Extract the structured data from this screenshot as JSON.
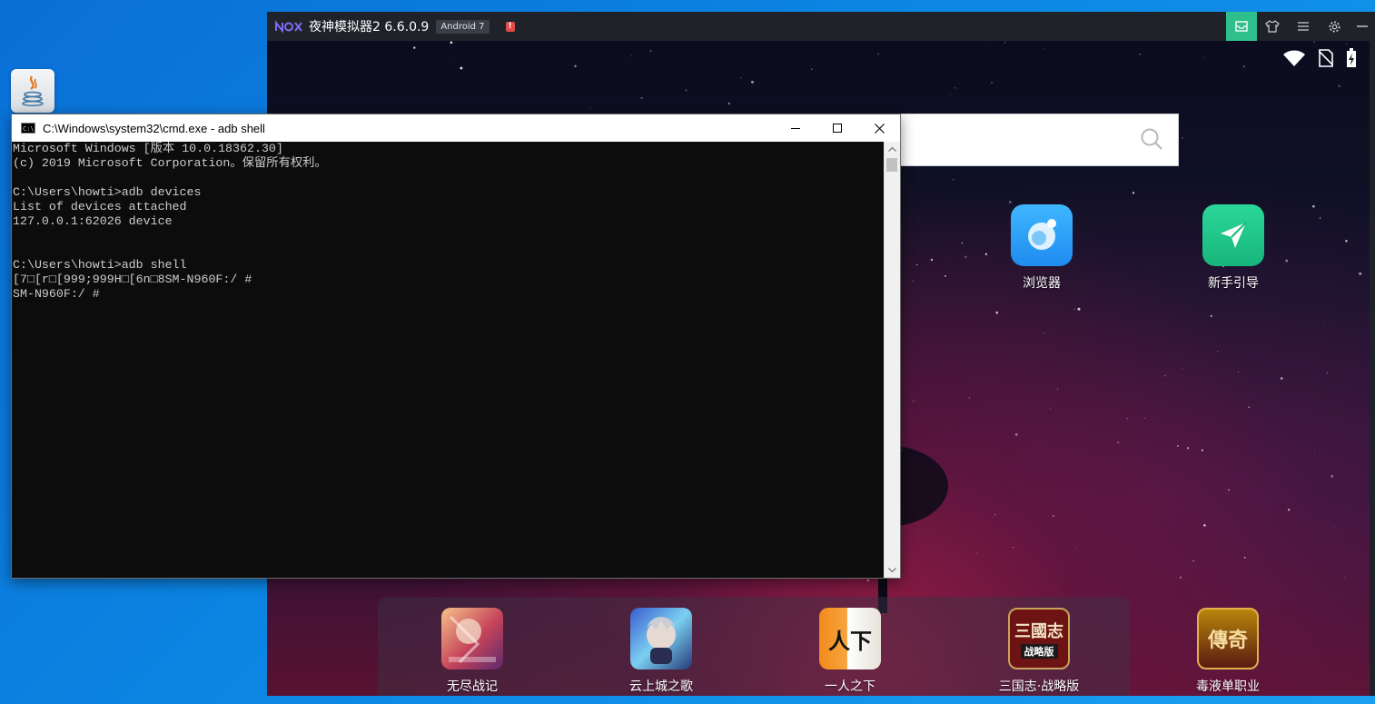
{
  "desktop": {
    "java_icon": "java-icon"
  },
  "nox": {
    "logo": "nox",
    "title": "夜神模拟器2 6.6.0.9",
    "android_badge": "Android 7",
    "alert_badge": "!",
    "controls": [
      "mail-icon",
      "shirt-icon",
      "menu-icon",
      "gear-icon",
      "minimize-icon"
    ],
    "status_icons": [
      "wifi-icon",
      "no-sim-icon",
      "battery-icon"
    ],
    "search_icon": "search-icon",
    "apps": [
      {
        "label": "浏览器",
        "icon": "browser-icon",
        "color": "#2aa6f7"
      },
      {
        "label": "新手引导",
        "icon": "guide-icon",
        "color": "#21c48c"
      }
    ],
    "dock": [
      {
        "label": "无尽战记",
        "icon": "game-icon"
      },
      {
        "label": "云上城之歌",
        "icon": "game-icon"
      },
      {
        "label": "一人之下",
        "icon": "game-icon",
        "glyph": "人下"
      },
      {
        "label": "三国志·战略版",
        "icon": "game-icon",
        "glyph": "三國志",
        "sub": "战略版"
      },
      {
        "label": "毒液单职业",
        "icon": "game-icon",
        "glyph": "傳奇"
      }
    ]
  },
  "cmd": {
    "title": "C:\\Windows\\system32\\cmd.exe - adb  shell",
    "icon_text": "C:\\",
    "lines": [
      "Microsoft Windows [版本 10.0.18362.30]",
      "(c) 2019 Microsoft Corporation。保留所有权利。",
      "",
      "C:\\Users\\howti>adb devices",
      "List of devices attached",
      "127.0.0.1:62026 device",
      "",
      "",
      "C:\\Users\\howti>adb shell",
      "[7□[r□[999;999H□[6n□8SM-N960F:/ #",
      "SM-N960F:/ #"
    ]
  }
}
